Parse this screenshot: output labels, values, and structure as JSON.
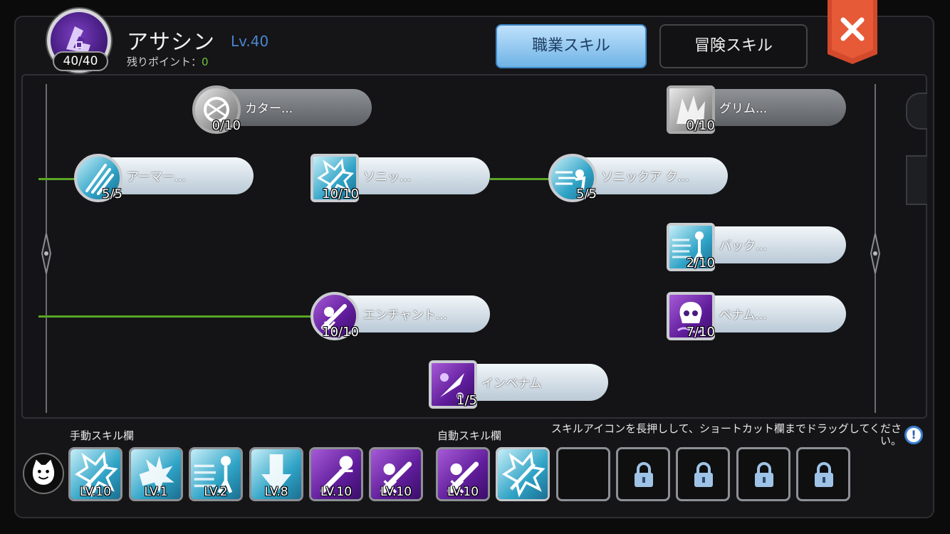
{
  "header": {
    "class_name": "アサシン",
    "level": "Lv.40",
    "points": "40/40",
    "remaining_label": "残りポイント：",
    "remaining_value": "0"
  },
  "tabs": [
    {
      "label": "職業スキル",
      "active": true
    },
    {
      "label": "冒険スキル",
      "active": false
    }
  ],
  "tree": {
    "nodes": [
      {
        "label": "カター...",
        "level": "0/10",
        "shape": "circle",
        "color": "grey",
        "icon": "katar-skill-icon",
        "dim": true
      },
      {
        "label": "グリム...",
        "level": "0/10",
        "shape": "square",
        "color": "grey",
        "icon": "grim-skill-icon",
        "dim": true
      },
      {
        "label": "アーマー...",
        "level": "5/5",
        "shape": "circle",
        "color": "blue",
        "icon": "claw-slash-icon"
      },
      {
        "label": "ソニッ...",
        "level": "10/10",
        "shape": "square",
        "color": "blue",
        "icon": "sonic-blow-icon"
      },
      {
        "label": "ソニックア ク...",
        "level": "5/5",
        "shape": "circle",
        "color": "blue",
        "icon": "sonic-accel-icon"
      },
      {
        "label": "バック...",
        "level": "2/10",
        "shape": "square",
        "color": "blue",
        "icon": "back-step-icon"
      },
      {
        "label": "エンチャント...",
        "level": "10/10",
        "shape": "circle",
        "color": "purple",
        "icon": "enchant-poison-icon"
      },
      {
        "label": "ベナム...",
        "level": "7/10",
        "shape": "square",
        "color": "purple",
        "icon": "venom-skull-icon"
      },
      {
        "label": "インベナム",
        "level": "1/5",
        "shape": "square",
        "color": "purple",
        "icon": "envenom-dagger-icon"
      }
    ]
  },
  "shortcuts": {
    "manual_title": "手動スキル欄",
    "auto_title": "自動スキル欄",
    "hint": "スキルアイコンを長押しして、ショートカット欄までドラッグしてください。",
    "manual": [
      {
        "level": "LV.10",
        "icon": "sonic-blow-icon",
        "color": "blue"
      },
      {
        "level": "LV.1",
        "icon": "impact-icon",
        "color": "blue"
      },
      {
        "level": "LV.2",
        "icon": "back-step-icon",
        "color": "blue"
      },
      {
        "level": "LV.8",
        "icon": "down-arrow-icon",
        "color": "blue"
      },
      {
        "level": "LV.10",
        "icon": "enchant-poison-icon",
        "color": "purple"
      },
      {
        "level": "LV.10",
        "icon": "enchant-poison-icon",
        "color": "purple"
      }
    ],
    "auto": [
      {
        "level": "LV.10",
        "icon": "enchant-poison-icon",
        "color": "purple"
      },
      {
        "level": "",
        "icon": "sonic-blow-icon",
        "color": "blue"
      },
      {
        "level": "",
        "icon": "empty-slot",
        "color": "empty"
      },
      {
        "level": "",
        "icon": "lock-icon",
        "color": "locked"
      },
      {
        "level": "",
        "icon": "lock-icon",
        "color": "locked"
      },
      {
        "level": "",
        "icon": "lock-icon",
        "color": "locked"
      },
      {
        "level": "",
        "icon": "lock-icon",
        "color": "locked"
      }
    ]
  },
  "colors": {
    "accent_blue": "#4a86cf",
    "remaining_green": "#6cc23c",
    "link_green": "#5aa526",
    "close_red": "#d2492b"
  }
}
